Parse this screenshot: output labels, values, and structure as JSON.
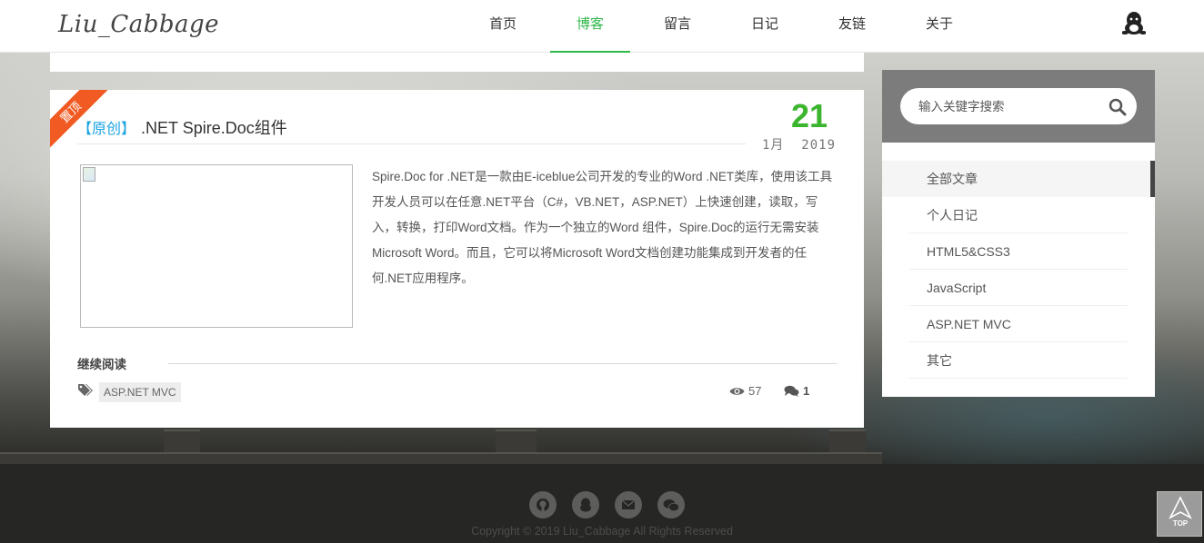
{
  "header": {
    "logo": "Liu_Cabbage",
    "nav": [
      {
        "label": "首页",
        "active": false
      },
      {
        "label": "博客",
        "active": true
      },
      {
        "label": "留言",
        "active": false
      },
      {
        "label": "日记",
        "active": false
      },
      {
        "label": "友链",
        "active": false
      },
      {
        "label": "关于",
        "active": false
      }
    ],
    "right_icon": "qq-icon",
    "accent_color": "#2fb84a"
  },
  "article": {
    "ribbon": "置顶",
    "tag": "【原创】",
    "title": ".NET Spire.Doc组件",
    "date_day": "21",
    "date_month_year": "1月  2019",
    "summary": "Spire.Doc for .NET是一款由E-iceblue公司开发的专业的Word .NET类库，使用该工具开发人员可以在任意.NET平台（C#，VB.NET，ASP.NET）上快速创建，读取，写入，转换，打印Word文档。作为一个独立的Word 组件，Spire.Doc的运行无需安装Microsoft Word。而且，它可以将Microsoft Word文档创建功能集成到开发者的任何.NET应用程序。",
    "read_more": "继续阅读",
    "category_tag": "ASP.NET MVC",
    "views": "57",
    "comments": "1"
  },
  "sidebar": {
    "search_placeholder": "输入关键字搜索",
    "categories": [
      {
        "label": "全部文章",
        "active": true
      },
      {
        "label": "个人日记",
        "active": false
      },
      {
        "label": "HTML5&CSS3",
        "active": false
      },
      {
        "label": "JavaScript",
        "active": false
      },
      {
        "label": "ASP.NET MVC",
        "active": false
      },
      {
        "label": "其它",
        "active": false
      }
    ]
  },
  "footer": {
    "social_icons": [
      "github-icon",
      "qq-icon",
      "mail-icon",
      "wechat-icon"
    ],
    "copyright": "Copyright © 2019 Liu_Cabbage All Rights Reserved",
    "to_top_label": "TOP"
  }
}
